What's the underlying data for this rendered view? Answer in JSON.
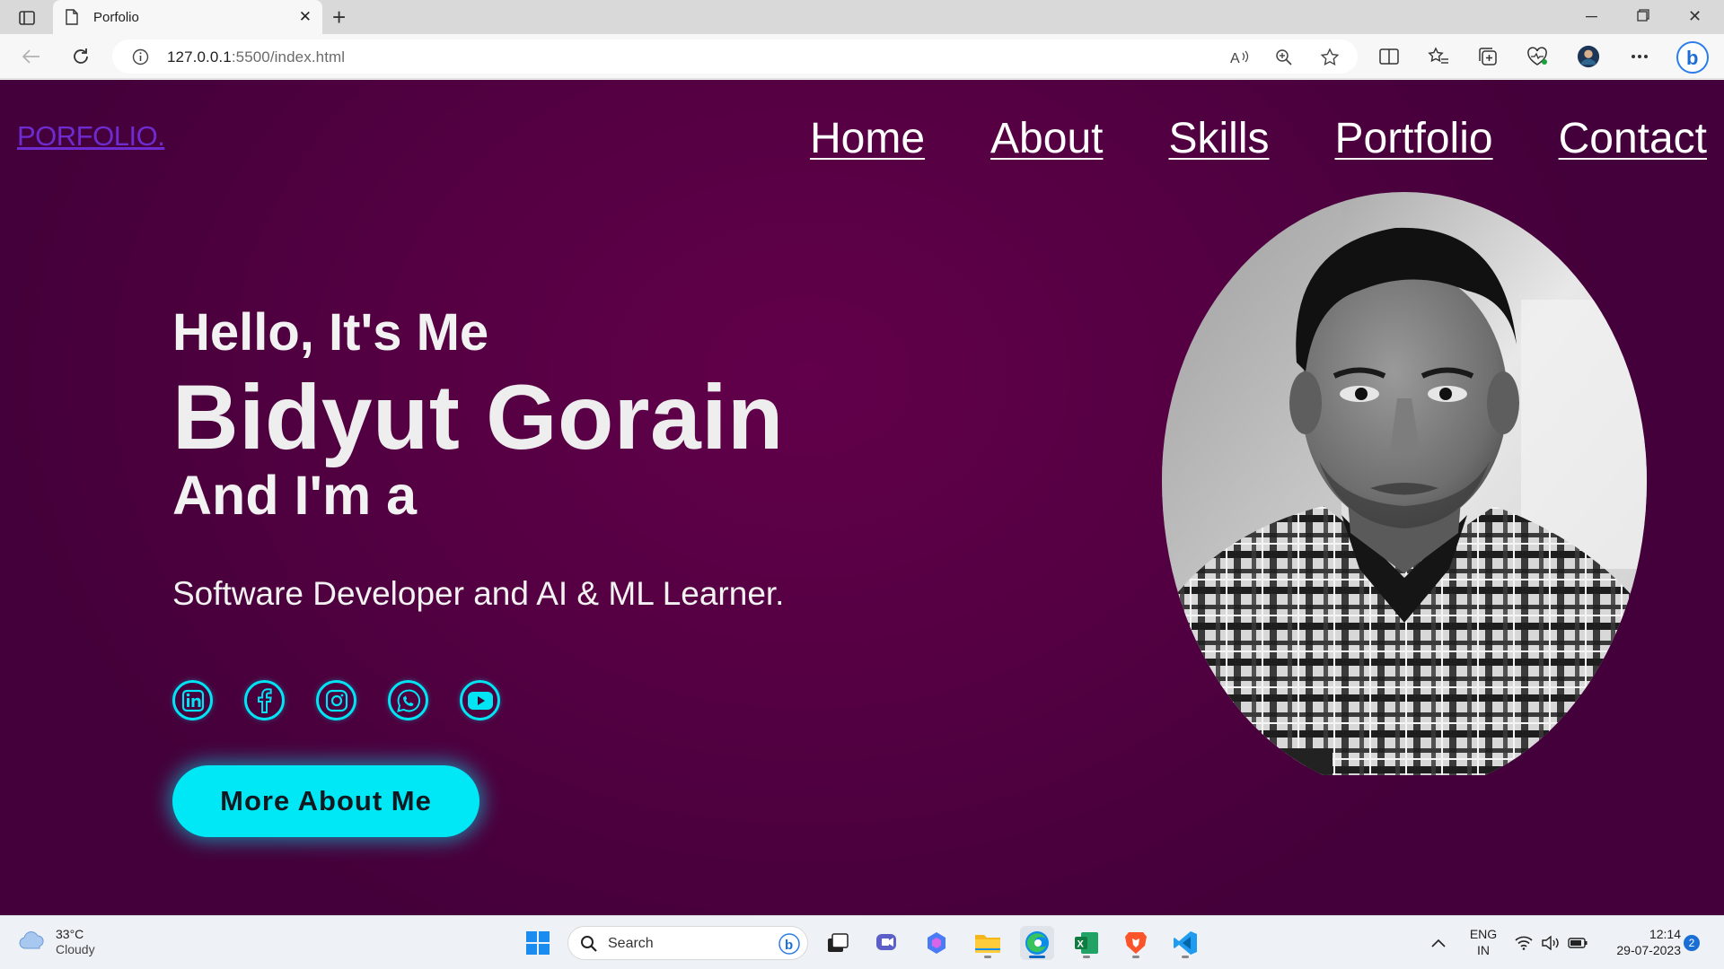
{
  "browser": {
    "tab_title": "Porfolio",
    "url_host": "127.0.0.1",
    "url_rest": ":5500/index.html"
  },
  "page": {
    "logo": "PORFOLIO.",
    "nav": [
      "Home",
      "About",
      "Skills",
      "Portfolio",
      "Contact"
    ],
    "greeting": "Hello, It's Me",
    "name": "Bidyut Gorain",
    "intro": "And I'm a",
    "role": "Software Developer and AI & ML Learner.",
    "socials": [
      "linkedin-icon",
      "facebook-icon",
      "instagram-icon",
      "whatsapp-icon",
      "youtube-icon"
    ],
    "cta_label": "More About Me",
    "colors": {
      "accent": "#00e7f5",
      "background": "#560043",
      "logo": "#6e2bd0"
    }
  },
  "taskbar": {
    "weather_temp": "33°C",
    "weather_cond": "Cloudy",
    "search_placeholder": "Search",
    "lang_top": "ENG",
    "lang_bottom": "IN",
    "time": "12:14",
    "date": "29-07-2023",
    "notifications": "2"
  }
}
